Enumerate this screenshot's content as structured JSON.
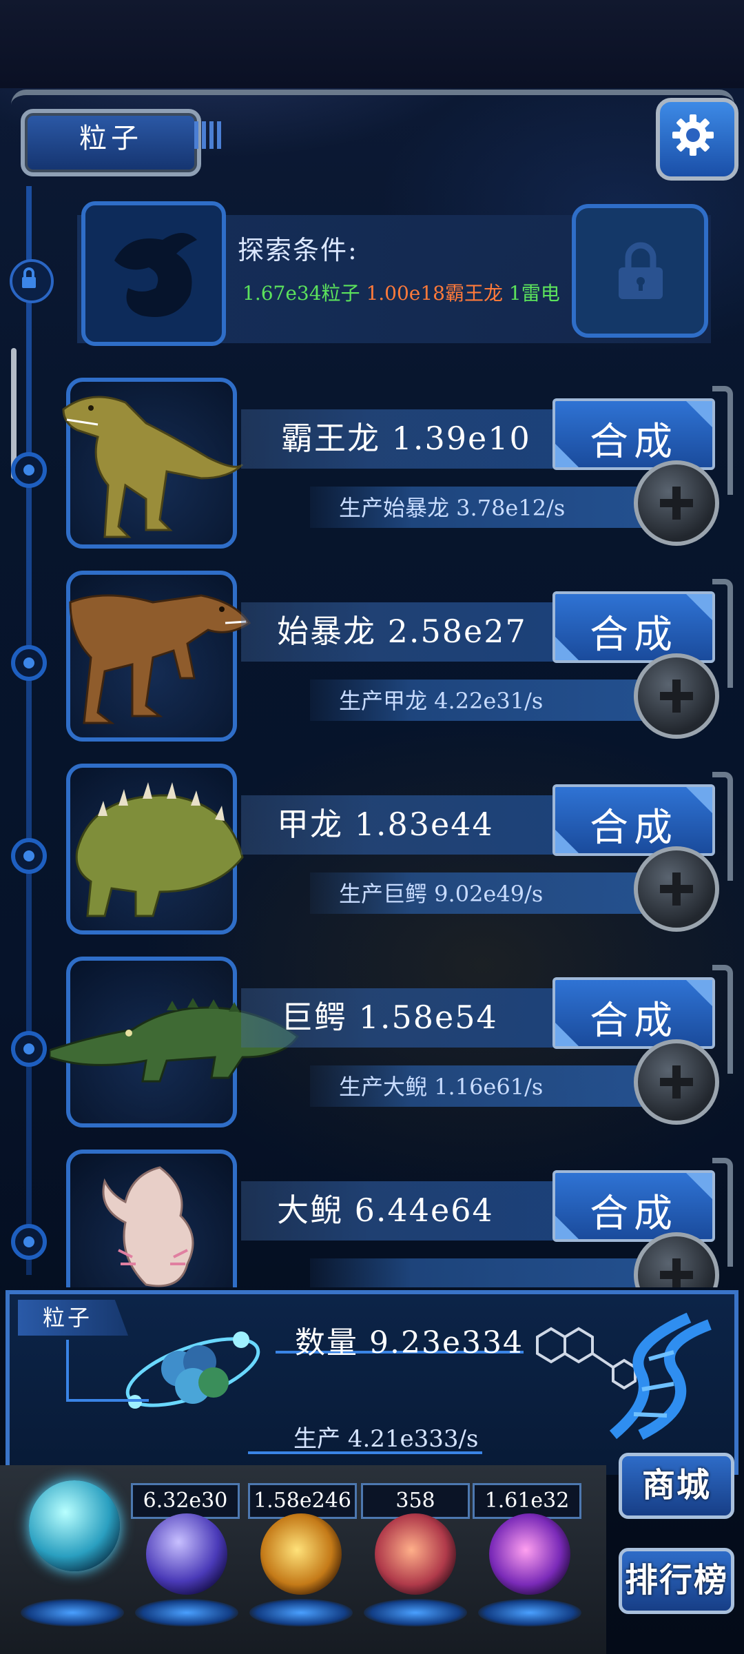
{
  "header": {
    "tab_label": "粒子"
  },
  "explore": {
    "title": "探索条件:",
    "req_particles": "1.67e34粒子",
    "req_trex": "1.00e18霸王龙",
    "req_thunder": "1雷电"
  },
  "creatures": [
    {
      "name": "霸王龙 1.39e10",
      "produce": "生产始暴龙 3.78e12/s",
      "synth_label": "合成"
    },
    {
      "name": "始暴龙 2.58e27",
      "produce": "生产甲龙 4.22e31/s",
      "synth_label": "合成"
    },
    {
      "name": "甲龙 1.83e44",
      "produce": "生产巨鳄 9.02e49/s",
      "synth_label": "合成"
    },
    {
      "name": "巨鳄 1.58e54",
      "produce": "生产大鲵 1.16e61/s",
      "synth_label": "合成"
    },
    {
      "name": "大鲵 6.44e64",
      "produce": "",
      "synth_label": "合成"
    }
  ],
  "info": {
    "tab_label": "粒子",
    "quantity": "数量 9.23e334",
    "production": "生产 4.21e333/s"
  },
  "resources": [
    "6.32e30",
    "1.58e246",
    "358",
    "1.61e32"
  ],
  "buttons": {
    "shop": "商城",
    "rank": "排行榜"
  },
  "colors": {
    "accent": "#2f73d4",
    "green_req": "#5ce35c",
    "orange_req": "#ff7a3a"
  }
}
